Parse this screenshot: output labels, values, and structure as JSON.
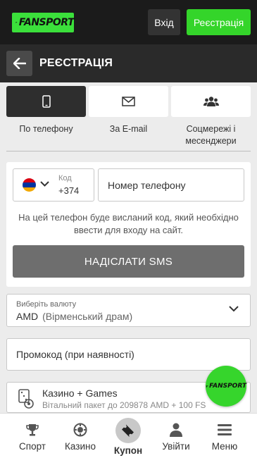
{
  "header": {
    "logo_text": "FANSPORT",
    "login_label": "Вхід",
    "register_label": "Реєстрація",
    "accent_color": "#34d52a"
  },
  "titlebar": {
    "back_icon": "arrow-left-icon",
    "title": "РЕЄСТРАЦІЯ"
  },
  "methods": [
    {
      "label": "По телефону",
      "icon": "phone-icon",
      "active": true
    },
    {
      "label": "За E-mail",
      "icon": "envelope-icon",
      "active": false
    },
    {
      "label": "Соцмережі і месенджери",
      "icon": "users-icon",
      "active": false
    }
  ],
  "phone_form": {
    "code_label": "Код",
    "code_value": "+374",
    "flag": "armenia-flag-icon",
    "phone_placeholder": "Номер телефону",
    "hint": "На цей телефон буде висланий код, який необхідно ввести для входу на сайт.",
    "sms_button": "НАДІСЛАТИ SMS"
  },
  "currency": {
    "label": "Виберіть валюту",
    "code": "AMD",
    "name": "(Вірменський драм)"
  },
  "promo": {
    "placeholder": "Промокод (при наявності)"
  },
  "bonus": {
    "title": "Казино + Games",
    "subtitle": "Вітальний пакет до 209878 AMD + 100 FS"
  },
  "fab": {
    "text": "FANSPORT"
  },
  "bottom_nav": [
    {
      "label": "Спорт",
      "icon": "trophy-icon"
    },
    {
      "label": "Казино",
      "icon": "casino-chip-icon"
    },
    {
      "label": "Купон",
      "icon": "ticket-icon"
    },
    {
      "label": "Увійти",
      "icon": "user-icon"
    },
    {
      "label": "Меню",
      "icon": "menu-icon"
    }
  ]
}
